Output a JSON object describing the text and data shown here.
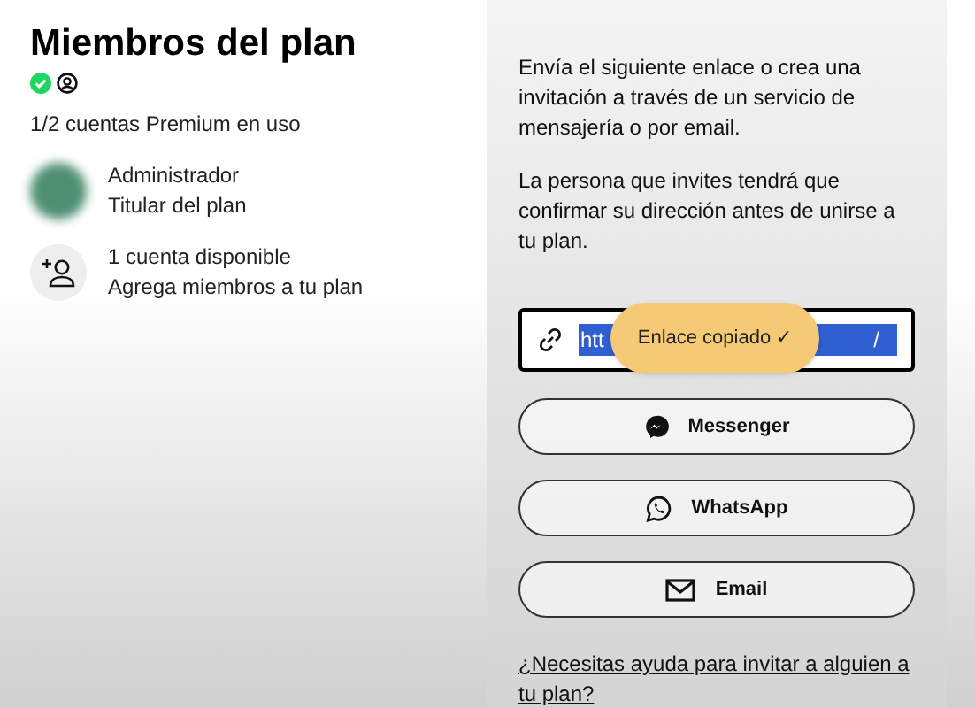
{
  "title": "Miembros del plan",
  "usage": "1/2 cuentas Premium en uso",
  "members": [
    {
      "kind": "avatar",
      "name": "Administrador",
      "role": "Titular del plan"
    },
    {
      "kind": "add",
      "name": "1 cuenta disponible",
      "role": "Agrega miembros a tu plan"
    }
  ],
  "invite": {
    "intro": "Envía el siguiente enlace o crea una invitación a través de un servicio de mensajería o por email.",
    "note": "La persona que invites tendrá que confirmar su dirección antes de unirse a tu plan.",
    "link_field": {
      "value_start": "htt",
      "value_end": "/",
      "toast": "Enlace copiado ✓"
    },
    "buttons": [
      {
        "kind": "messenger",
        "label": "Messenger"
      },
      {
        "kind": "whatsapp",
        "label": "WhatsApp"
      },
      {
        "kind": "email",
        "label": "Email"
      }
    ],
    "help_link": "¿Necesitas ayuda para invitar a alguien a tu plan?"
  }
}
